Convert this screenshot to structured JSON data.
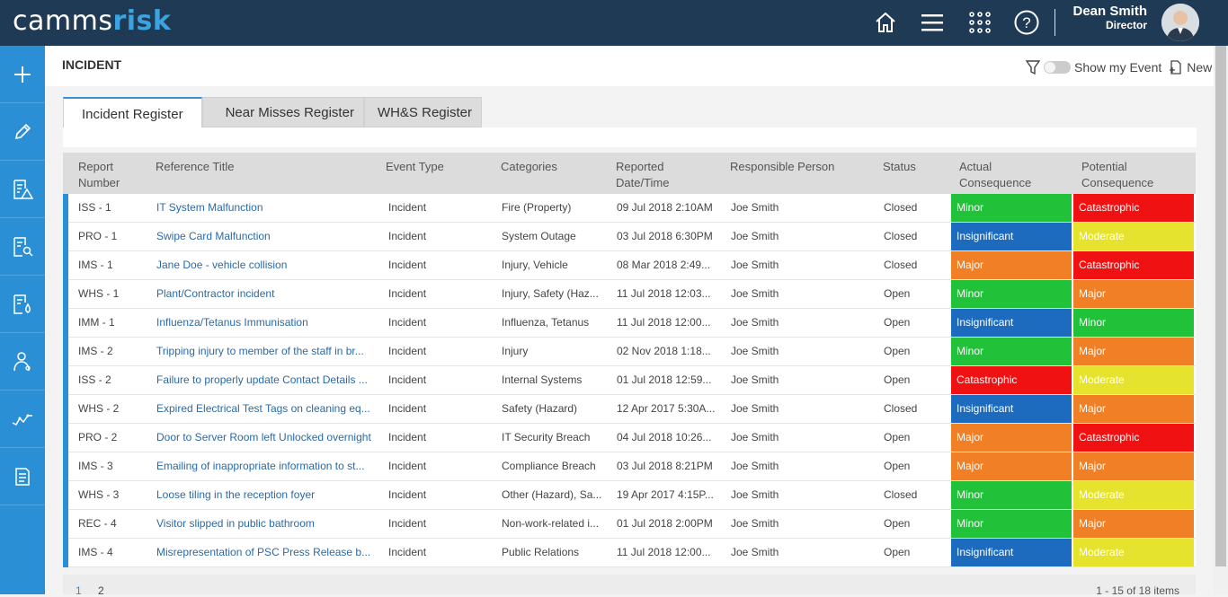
{
  "app": {
    "logo_prefix": "camms",
    "logo_suffix": "risk"
  },
  "user": {
    "name": "Dean Smith",
    "role": "Director"
  },
  "topnav": {
    "icons": [
      "home-icon",
      "menu-icon",
      "apps-grid-icon",
      "help-icon"
    ]
  },
  "sidebar": {
    "icons": [
      "plus-icon",
      "pencil-icon",
      "report-warning-icon",
      "report-search-icon",
      "report-drop-icon",
      "person-medical-icon",
      "trend-icon",
      "document-icon"
    ]
  },
  "page": {
    "title": "INCIDENT",
    "toggle_label": "Show my Event",
    "new_label": "New"
  },
  "tabs": [
    {
      "label": "Incident Register",
      "active": true
    },
    {
      "label": "Near Misses Register",
      "active": false
    },
    {
      "label": "WH&S Register",
      "active": false
    }
  ],
  "columns": {
    "report_number": "Report Number",
    "reference_title": "Reference Title",
    "event_type": "Event Type",
    "categories": "Categories",
    "reported": "Reported Date/Time",
    "responsible": "Responsible Person",
    "status": "Status",
    "actual": "Actual Consequence",
    "potential": "Potential Consequence"
  },
  "colors": {
    "Minor": "#22c13a",
    "Insignificant": "#1d6bbf",
    "Major": "#f07f25",
    "Catastrophic": "#f01212",
    "Moderate": "#e6e32e"
  },
  "rows": [
    {
      "num": "ISS - 1",
      "title": "IT System Malfunction",
      "type": "Incident",
      "cat": "Fire (Property)",
      "date": "09 Jul 2018 2:10AM",
      "person": "Joe Smith",
      "status": "Closed",
      "actual": "Minor",
      "potential": "Catastrophic"
    },
    {
      "num": "PRO - 1",
      "title": "Swipe Card Malfunction",
      "type": "Incident",
      "cat": "System Outage",
      "date": "03 Jul 2018 6:30PM",
      "person": "Joe Smith",
      "status": "Closed",
      "actual": "Insignificant",
      "potential": "Moderate"
    },
    {
      "num": "IMS - 1",
      "title": "Jane Doe - vehicle collision",
      "type": "Incident",
      "cat": "Injury, Vehicle",
      "date": "08 Mar 2018 2:49...",
      "person": "Joe Smith",
      "status": "Closed",
      "actual": "Major",
      "potential": "Catastrophic"
    },
    {
      "num": "WHS - 1",
      "title": "Plant/Contractor incident",
      "type": "Incident",
      "cat": "Injury, Safety (Haz...",
      "date": "11 Jul 2018 12:03...",
      "person": "Joe Smith",
      "status": "Open",
      "actual": "Minor",
      "potential": "Major"
    },
    {
      "num": "IMM - 1",
      "title": "Influenza/Tetanus Immunisation",
      "type": "Incident",
      "cat": "Influenza, Tetanus",
      "date": "11 Jul 2018 12:00...",
      "person": "Joe Smith",
      "status": "Open",
      "actual": "Insignificant",
      "potential": "Minor"
    },
    {
      "num": "IMS - 2",
      "title": "Tripping injury to member of the staff in br...",
      "type": "Incident",
      "cat": "Injury",
      "date": "02 Nov 2018 1:18...",
      "person": "Joe Smith",
      "status": "Open",
      "actual": "Minor",
      "potential": "Major"
    },
    {
      "num": "ISS - 2",
      "title": "Failure to properly update Contact Details ...",
      "type": "Incident",
      "cat": "Internal Systems",
      "date": "01 Jul 2018 12:59...",
      "person": "Joe Smith",
      "status": "Open",
      "actual": "Catastrophic",
      "potential": "Moderate"
    },
    {
      "num": "WHS - 2",
      "title": "Expired Electrical Test Tags on cleaning eq...",
      "type": "Incident",
      "cat": "Safety (Hazard)",
      "date": "12 Apr 2017 5:30A...",
      "person": "Joe Smith",
      "status": "Closed",
      "actual": "Insignificant",
      "potential": "Major"
    },
    {
      "num": "PRO - 2",
      "title": "Door to Server Room left Unlocked overnight",
      "type": "Incident",
      "cat": "IT Security Breach",
      "date": "04 Jul 2018 10:26...",
      "person": "Joe Smith",
      "status": "Open",
      "actual": "Major",
      "potential": "Catastrophic"
    },
    {
      "num": "IMS - 3",
      "title": "Emailing of inappropriate information to st...",
      "type": "Incident",
      "cat": "Compliance Breach",
      "date": "03 Jul 2018 8:21PM",
      "person": "Joe Smith",
      "status": "Open",
      "actual": "Major",
      "potential": "Major"
    },
    {
      "num": "WHS - 3",
      "title": "Loose tiling in the reception foyer",
      "type": "Incident",
      "cat": "Other (Hazard), Sa...",
      "date": "19 Apr 2017 4:15P...",
      "person": "Joe Smith",
      "status": "Closed",
      "actual": "Minor",
      "potential": "Moderate"
    },
    {
      "num": "REC - 4",
      "title": "Visitor slipped in public bathroom",
      "type": "Incident",
      "cat": "Non-work-related i...",
      "date": "01 Jul 2018 2:00PM",
      "person": "Joe Smith",
      "status": "Open",
      "actual": "Minor",
      "potential": "Major"
    },
    {
      "num": "IMS - 4",
      "title": "Misrepresentation of PSC Press Release b...",
      "type": "Incident",
      "cat": "Public Relations",
      "date": "11 Jul 2018 12:00...",
      "person": "Joe Smith",
      "status": "Open",
      "actual": "Insignificant",
      "potential": "Moderate"
    }
  ],
  "pager": {
    "pages": [
      "1",
      "2"
    ],
    "summary": "1 - 15 of 18 items"
  }
}
